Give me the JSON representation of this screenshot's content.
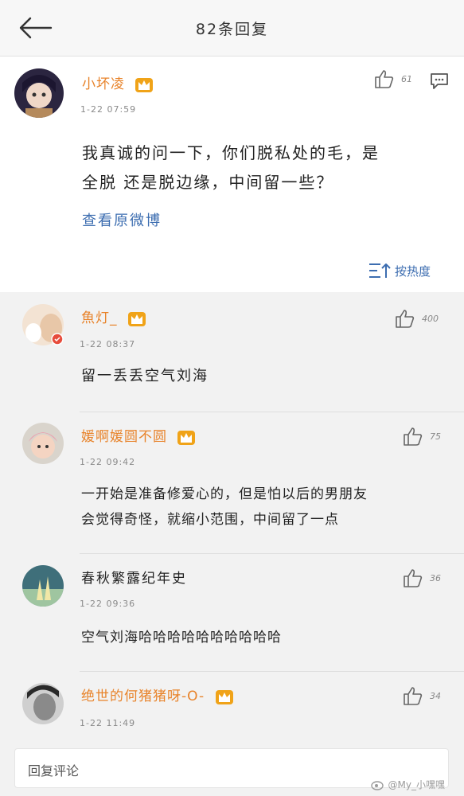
{
  "header": {
    "title": "82条回复"
  },
  "main_post": {
    "username": "小坏凌",
    "time": "1-22 07:59",
    "like_count": "61",
    "text_line1": "我真诚的问一下，你们脱私处的毛，是",
    "text_line2": "全脱 还是脱边缘，中间留一些？",
    "view_original": "查看原微博"
  },
  "sort_label": "按热度",
  "replies": [
    {
      "username": "魚灯_",
      "time": "1-22 08:37",
      "like_count": "400",
      "text_line1": "留一丢丢空气刘海",
      "text_line2": ""
    },
    {
      "username": "媛啊媛圆不圆",
      "time": "1-22 09:42",
      "like_count": "75",
      "text_line1": "一开始是准备修爱心的，但是怕以后的男朋友",
      "text_line2": "会觉得奇怪，就缩小范围，中间留了一点"
    },
    {
      "username": "春秋繁露纪年史",
      "time": "1-22 09:36",
      "like_count": "36",
      "text_line1": "空气刘海哈哈哈哈哈哈哈哈哈哈",
      "text_line2": ""
    },
    {
      "username": "绝世的何猪猪呀-O-",
      "time": "1-22 11:49",
      "like_count": "34",
      "text_line1": "",
      "text_line2": ""
    }
  ],
  "input": {
    "placeholder": "回复评论"
  },
  "watermark": "@My_小嘿嘿",
  "colors": {
    "username": "#e8832a",
    "link": "#3c6db0",
    "crown": "#f0a318"
  }
}
